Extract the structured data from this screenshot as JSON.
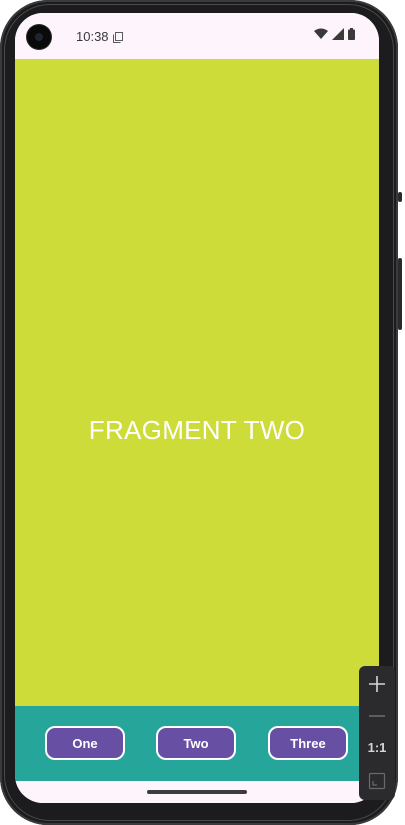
{
  "status_bar": {
    "time": "10:38",
    "icons": [
      "clipboard-icon",
      "wifi-icon",
      "signal-icon",
      "battery-icon"
    ]
  },
  "fragment": {
    "title": "FRAGMENT TWO",
    "background_color": "#cddc39"
  },
  "bottom_bar": {
    "background_color": "#26a69a",
    "buttons": [
      {
        "label": "One"
      },
      {
        "label": "Two"
      },
      {
        "label": "Three"
      }
    ],
    "button_color": "#6750a4"
  },
  "zoom_controls": {
    "ratio_label": "1:1"
  }
}
